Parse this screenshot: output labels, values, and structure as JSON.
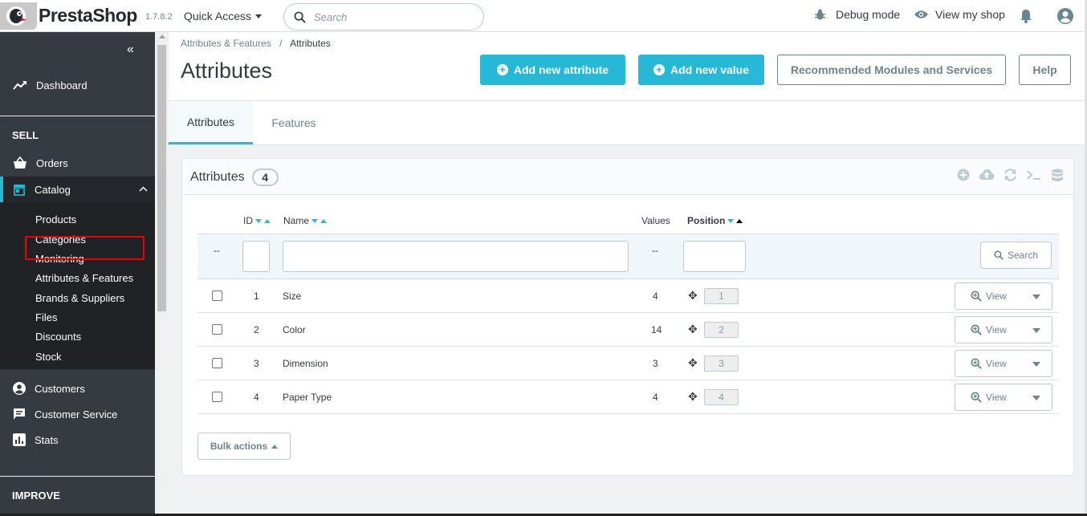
{
  "header": {
    "logo_text": "PrestaShop",
    "version": "1.7.8.2",
    "quick_access": "Quick Access",
    "search_placeholder": "Search",
    "debug_mode": "Debug mode",
    "view_shop": "View my shop"
  },
  "sidebar": {
    "dashboard": "Dashboard",
    "sell_title": "SELL",
    "orders": "Orders",
    "catalog": "Catalog",
    "catalog_sub": [
      "Products",
      "Categories",
      "Monitoring",
      "Attributes & Features",
      "Brands & Suppliers",
      "Files",
      "Discounts",
      "Stock"
    ],
    "customers": "Customers",
    "customer_service": "Customer Service",
    "stats": "Stats",
    "improve_title": "IMPROVE"
  },
  "page": {
    "breadcrumb_parent": "Attributes & Features",
    "breadcrumb_sep": "/",
    "breadcrumb_current": "Attributes",
    "title": "Attributes",
    "btn_add_attribute": "Add new attribute",
    "btn_add_value": "Add new value",
    "btn_recommended": "Recommended Modules and Services",
    "btn_help": "Help"
  },
  "tabs": [
    "Attributes",
    "Features"
  ],
  "card": {
    "title": "Attributes",
    "count": "4",
    "columns": {
      "id": "ID",
      "name": "Name",
      "values": "Values",
      "position": "Position"
    },
    "filter_dash": "--",
    "search_btn": "Search",
    "view_label": "View",
    "bulk_actions": "Bulk actions",
    "rows": [
      {
        "id": "1",
        "name": "Size",
        "values": "4",
        "position": "1"
      },
      {
        "id": "2",
        "name": "Color",
        "values": "14",
        "position": "2"
      },
      {
        "id": "3",
        "name": "Dimension",
        "values": "3",
        "position": "3"
      },
      {
        "id": "4",
        "name": "Paper Type",
        "values": "4",
        "position": "4"
      }
    ]
  },
  "colors": {
    "accent": "#25b9d7",
    "sidebar": "#363a41",
    "highlight": "#e00000"
  }
}
